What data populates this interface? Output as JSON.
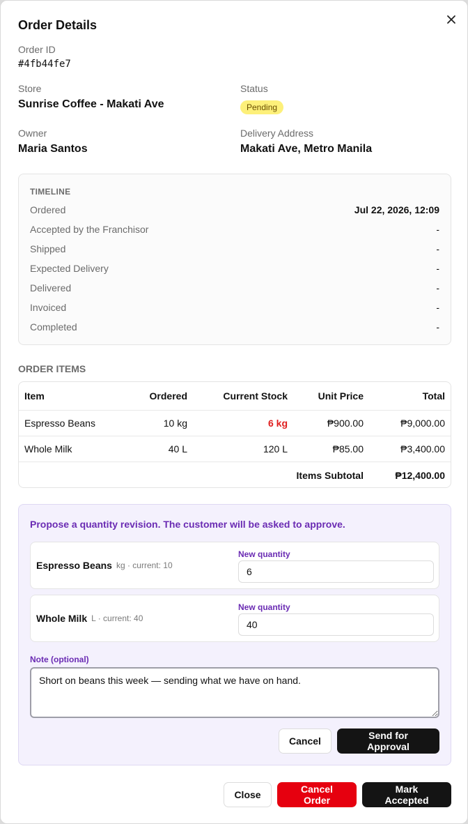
{
  "dialog": {
    "title": "Order Details",
    "close_icon": "close-icon"
  },
  "order": {
    "id_label": "Order ID",
    "id": "#4fb44fe7",
    "store_label": "Store",
    "store": "Sunrise Coffee - Makati Ave",
    "status_label": "Status",
    "status": "Pending",
    "owner_label": "Owner",
    "owner": "Maria Santos",
    "address_label": "Delivery Address",
    "address": "Makati Ave, Metro Manila"
  },
  "timeline": {
    "heading": "TIMELINE",
    "rows": [
      {
        "label": "Ordered",
        "value": "Jul 22, 2026, 12:09"
      },
      {
        "label": "Accepted by the Franchisor",
        "value": "-"
      },
      {
        "label": "Shipped",
        "value": "-"
      },
      {
        "label": "Expected Delivery",
        "value": "-"
      },
      {
        "label": "Delivered",
        "value": "-"
      },
      {
        "label": "Invoiced",
        "value": "-"
      },
      {
        "label": "Completed",
        "value": "-"
      }
    ]
  },
  "items": {
    "heading": "ORDER ITEMS",
    "columns": [
      "Item",
      "Ordered",
      "Current Stock",
      "Unit Price",
      "Total"
    ],
    "rows": [
      {
        "item": "Espresso Beans",
        "ordered": "10 kg",
        "stock": "6 kg",
        "price": "₱900.00",
        "total": "₱9,000.00",
        "low_stock": true
      },
      {
        "item": "Whole Milk",
        "ordered": "40 L",
        "stock": "120 L",
        "price": "₱85.00",
        "total": "₱3,400.00",
        "low_stock": false
      }
    ],
    "subtotal_label": "Items Subtotal",
    "subtotal": "₱12,400.00"
  },
  "revision": {
    "prompt": "Propose a quantity revision. The customer will be asked to approve.",
    "lines": [
      {
        "name": "Espresso Beans",
        "meta": "kg · current: 10",
        "qty_label": "New quantity",
        "qty": "6"
      },
      {
        "name": "Whole Milk",
        "meta": "L · current: 40",
        "qty_label": "New quantity",
        "qty": "40"
      }
    ],
    "note_label": "Note (optional)",
    "note": "Short on beans this week — sending what we have on hand.",
    "cancel_label": "Cancel",
    "send_label": "Send for Approval"
  },
  "footer": {
    "close_label": "Close",
    "cancel_order_label": "Cancel Order",
    "accept_label": "Mark Accepted"
  },
  "colors": {
    "danger": "#e6000f",
    "primary": "#141414",
    "accent": "#6a2bb3",
    "pending_badge": "#fdf07a",
    "low_stock": "#e02020"
  }
}
